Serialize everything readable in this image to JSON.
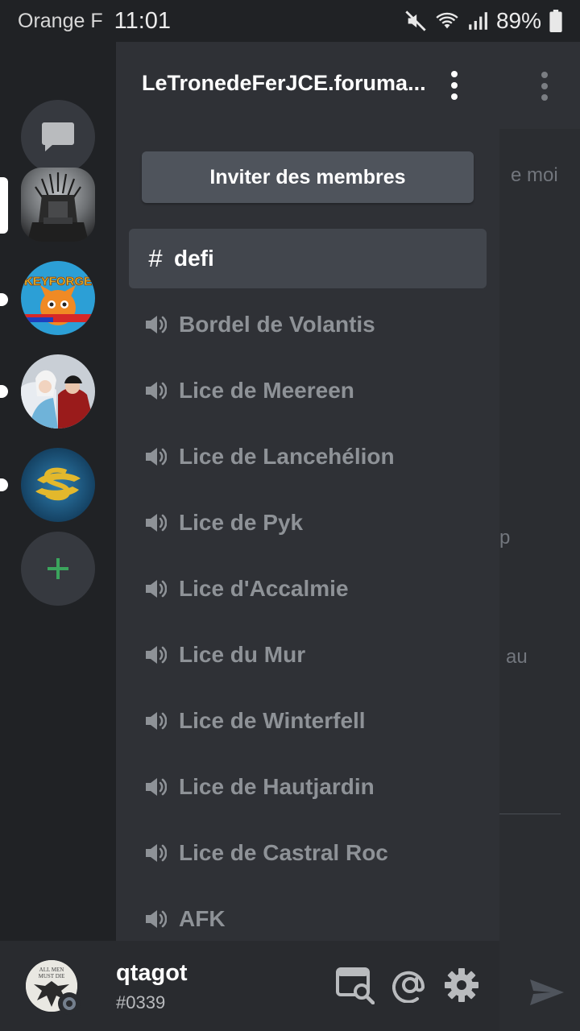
{
  "status_bar": {
    "carrier": "Orange F",
    "time": "11:01",
    "battery": "89%",
    "icons": [
      "mute-icon",
      "wifi-icon",
      "signal-icon",
      "battery-icon"
    ]
  },
  "chat_background": {
    "fragments": [
      {
        "text": "e moi"
      },
      {
        "text": "p"
      },
      {
        "text": "au"
      }
    ]
  },
  "guild_rail": {
    "servers": [
      {
        "name": "Le Trône de Fer server",
        "selected": true
      },
      {
        "name": "KeyForge France server",
        "unread": true,
        "logo_text": "KEYFORGE"
      },
      {
        "name": "Fantasy art server",
        "unread": true
      },
      {
        "name": "S logo server",
        "unread": true
      }
    ]
  },
  "drawer": {
    "server_name": "LeTronedeFerJCE.foruma...",
    "invite_label": "Inviter des membres",
    "channels": [
      {
        "type": "text",
        "label": "defi",
        "active": true
      },
      {
        "type": "voice",
        "label": "Bordel de Volantis"
      },
      {
        "type": "voice",
        "label": "Lice de Meereen"
      },
      {
        "type": "voice",
        "label": "Lice de Lancehélion"
      },
      {
        "type": "voice",
        "label": "Lice de Pyk"
      },
      {
        "type": "voice",
        "label": "Lice d'Accalmie"
      },
      {
        "type": "voice",
        "label": "Lice du Mur"
      },
      {
        "type": "voice",
        "label": "Lice de Winterfell"
      },
      {
        "type": "voice",
        "label": "Lice de Hautjardin"
      },
      {
        "type": "voice",
        "label": "Lice de Castral Roc"
      },
      {
        "type": "voice",
        "label": "AFK"
      }
    ]
  },
  "user_panel": {
    "username": "qtagot",
    "discriminator": "#0339",
    "avatar_text": "ALL MEN MUST DIE",
    "status": "offline"
  },
  "colors": {
    "rail": "#202225",
    "drawer": "#2f3136",
    "panel": "#292b2f",
    "accent_green": "#3ba55d"
  }
}
